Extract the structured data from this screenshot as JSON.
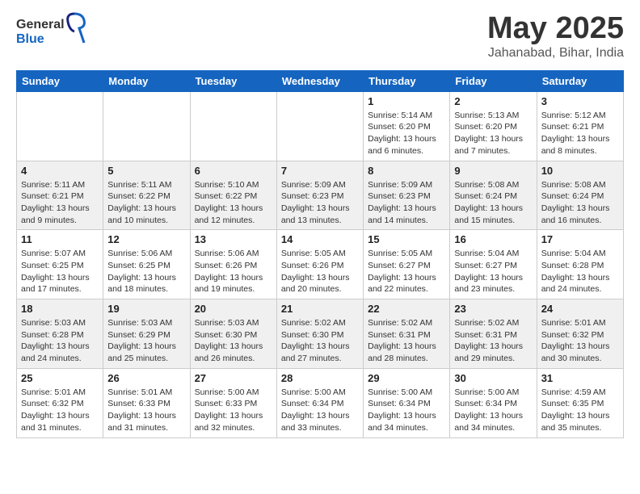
{
  "header": {
    "logo_general": "General",
    "logo_blue": "Blue",
    "month_title": "May 2025",
    "location": "Jahanabad, Bihar, India"
  },
  "weekdays": [
    "Sunday",
    "Monday",
    "Tuesday",
    "Wednesday",
    "Thursday",
    "Friday",
    "Saturday"
  ],
  "weeks": [
    [
      {
        "day": "",
        "info": ""
      },
      {
        "day": "",
        "info": ""
      },
      {
        "day": "",
        "info": ""
      },
      {
        "day": "",
        "info": ""
      },
      {
        "day": "1",
        "info": "Sunrise: 5:14 AM\nSunset: 6:20 PM\nDaylight: 13 hours\nand 6 minutes."
      },
      {
        "day": "2",
        "info": "Sunrise: 5:13 AM\nSunset: 6:20 PM\nDaylight: 13 hours\nand 7 minutes."
      },
      {
        "day": "3",
        "info": "Sunrise: 5:12 AM\nSunset: 6:21 PM\nDaylight: 13 hours\nand 8 minutes."
      }
    ],
    [
      {
        "day": "4",
        "info": "Sunrise: 5:11 AM\nSunset: 6:21 PM\nDaylight: 13 hours\nand 9 minutes."
      },
      {
        "day": "5",
        "info": "Sunrise: 5:11 AM\nSunset: 6:22 PM\nDaylight: 13 hours\nand 10 minutes."
      },
      {
        "day": "6",
        "info": "Sunrise: 5:10 AM\nSunset: 6:22 PM\nDaylight: 13 hours\nand 12 minutes."
      },
      {
        "day": "7",
        "info": "Sunrise: 5:09 AM\nSunset: 6:23 PM\nDaylight: 13 hours\nand 13 minutes."
      },
      {
        "day": "8",
        "info": "Sunrise: 5:09 AM\nSunset: 6:23 PM\nDaylight: 13 hours\nand 14 minutes."
      },
      {
        "day": "9",
        "info": "Sunrise: 5:08 AM\nSunset: 6:24 PM\nDaylight: 13 hours\nand 15 minutes."
      },
      {
        "day": "10",
        "info": "Sunrise: 5:08 AM\nSunset: 6:24 PM\nDaylight: 13 hours\nand 16 minutes."
      }
    ],
    [
      {
        "day": "11",
        "info": "Sunrise: 5:07 AM\nSunset: 6:25 PM\nDaylight: 13 hours\nand 17 minutes."
      },
      {
        "day": "12",
        "info": "Sunrise: 5:06 AM\nSunset: 6:25 PM\nDaylight: 13 hours\nand 18 minutes."
      },
      {
        "day": "13",
        "info": "Sunrise: 5:06 AM\nSunset: 6:26 PM\nDaylight: 13 hours\nand 19 minutes."
      },
      {
        "day": "14",
        "info": "Sunrise: 5:05 AM\nSunset: 6:26 PM\nDaylight: 13 hours\nand 20 minutes."
      },
      {
        "day": "15",
        "info": "Sunrise: 5:05 AM\nSunset: 6:27 PM\nDaylight: 13 hours\nand 22 minutes."
      },
      {
        "day": "16",
        "info": "Sunrise: 5:04 AM\nSunset: 6:27 PM\nDaylight: 13 hours\nand 23 minutes."
      },
      {
        "day": "17",
        "info": "Sunrise: 5:04 AM\nSunset: 6:28 PM\nDaylight: 13 hours\nand 24 minutes."
      }
    ],
    [
      {
        "day": "18",
        "info": "Sunrise: 5:03 AM\nSunset: 6:28 PM\nDaylight: 13 hours\nand 24 minutes."
      },
      {
        "day": "19",
        "info": "Sunrise: 5:03 AM\nSunset: 6:29 PM\nDaylight: 13 hours\nand 25 minutes."
      },
      {
        "day": "20",
        "info": "Sunrise: 5:03 AM\nSunset: 6:30 PM\nDaylight: 13 hours\nand 26 minutes."
      },
      {
        "day": "21",
        "info": "Sunrise: 5:02 AM\nSunset: 6:30 PM\nDaylight: 13 hours\nand 27 minutes."
      },
      {
        "day": "22",
        "info": "Sunrise: 5:02 AM\nSunset: 6:31 PM\nDaylight: 13 hours\nand 28 minutes."
      },
      {
        "day": "23",
        "info": "Sunrise: 5:02 AM\nSunset: 6:31 PM\nDaylight: 13 hours\nand 29 minutes."
      },
      {
        "day": "24",
        "info": "Sunrise: 5:01 AM\nSunset: 6:32 PM\nDaylight: 13 hours\nand 30 minutes."
      }
    ],
    [
      {
        "day": "25",
        "info": "Sunrise: 5:01 AM\nSunset: 6:32 PM\nDaylight: 13 hours\nand 31 minutes."
      },
      {
        "day": "26",
        "info": "Sunrise: 5:01 AM\nSunset: 6:33 PM\nDaylight: 13 hours\nand 31 minutes."
      },
      {
        "day": "27",
        "info": "Sunrise: 5:00 AM\nSunset: 6:33 PM\nDaylight: 13 hours\nand 32 minutes."
      },
      {
        "day": "28",
        "info": "Sunrise: 5:00 AM\nSunset: 6:34 PM\nDaylight: 13 hours\nand 33 minutes."
      },
      {
        "day": "29",
        "info": "Sunrise: 5:00 AM\nSunset: 6:34 PM\nDaylight: 13 hours\nand 34 minutes."
      },
      {
        "day": "30",
        "info": "Sunrise: 5:00 AM\nSunset: 6:34 PM\nDaylight: 13 hours\nand 34 minutes."
      },
      {
        "day": "31",
        "info": "Sunrise: 4:59 AM\nSunset: 6:35 PM\nDaylight: 13 hours\nand 35 minutes."
      }
    ]
  ]
}
